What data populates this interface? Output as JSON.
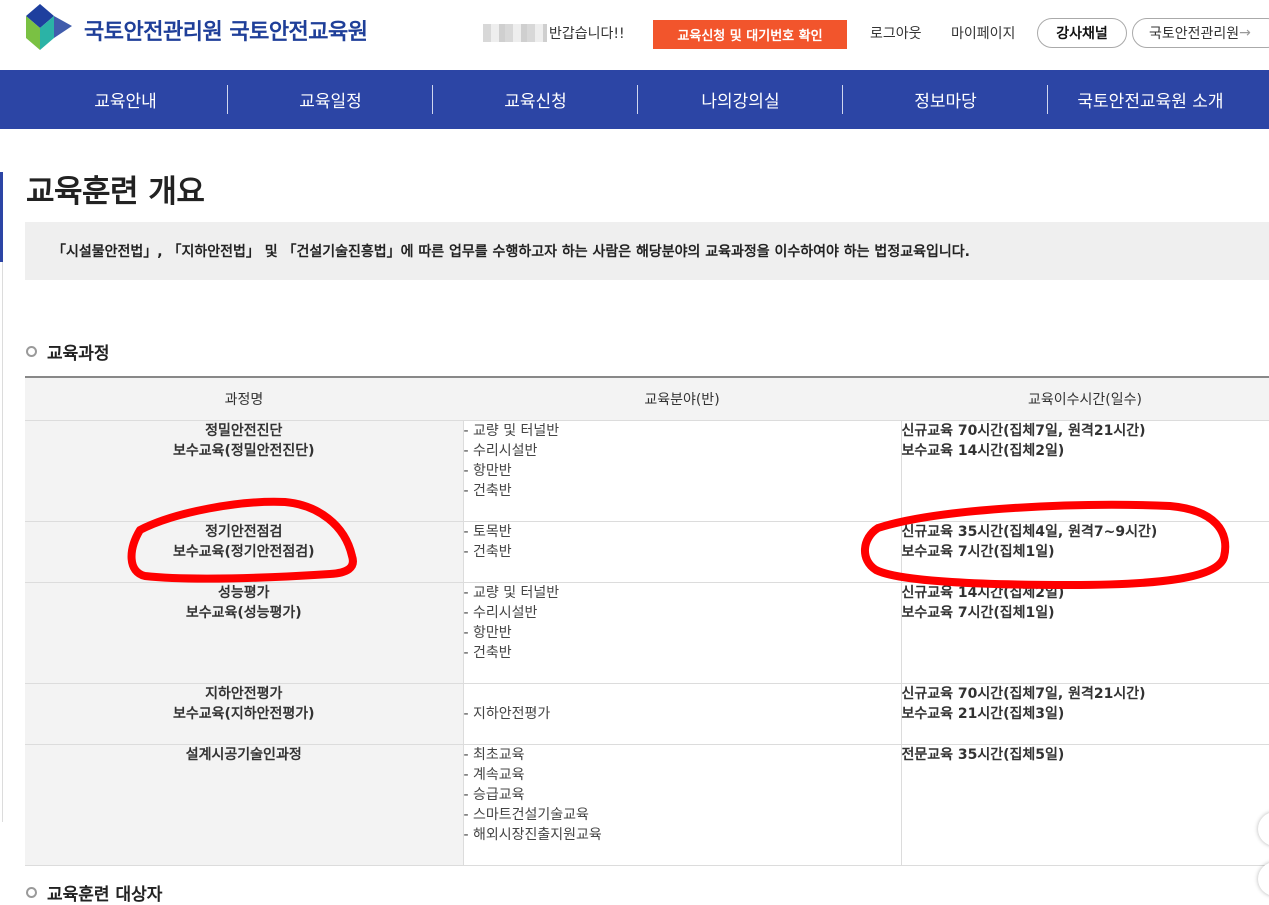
{
  "header": {
    "logo_text": "국토안전관리원 국토안전교육원",
    "greeting": "반갑습니다!!",
    "apply_button": "교육신청 및 대기번호 확인",
    "logout": "로그아웃",
    "mypage": "마이페이지",
    "instructor_channel": "강사채널",
    "kalis_link": "국토안전관리원",
    "kalis_arrow": "→"
  },
  "nav": [
    "교육안내",
    "교육일정",
    "교육신청",
    "나의강의실",
    "정보마당",
    "국토안전교육원 소개"
  ],
  "page": {
    "title": "교육훈련 개요",
    "intro": "「시설물안전법」, 「지하안전법」 및 「건설기술진흥법」에 따른 업무를 수행하고자 하는 사람은 해당분야의 교육과정을 이수하여야 하는 법정교육입니다."
  },
  "section1": "교육과정",
  "section2": "교육훈련 대상자",
  "table": {
    "headers": [
      "과정명",
      "교육분야(반)",
      "교육이수시간(일수)"
    ],
    "rows": [
      {
        "name": [
          "정밀안전진단",
          "보수교육(정밀안전진단)"
        ],
        "fields": [
          "- 교량 및 터널반",
          "- 수리시설반",
          "- 항만반",
          "- 건축반"
        ],
        "hours": [
          "신규교육 70시간(집체7일, 원격21시간)",
          "보수교육 14시간(집체2일)"
        ]
      },
      {
        "name": [
          "정기안전점검",
          "보수교육(정기안전점검)"
        ],
        "fields": [
          "- 토목반",
          "- 건축반"
        ],
        "hours": [
          "신규교육 35시간(집체4일, 원격7~9시간)",
          "보수교육 7시간(집체1일)"
        ]
      },
      {
        "name": [
          "성능평가",
          "보수교육(성능평가)"
        ],
        "fields": [
          "- 교량 및 터널반",
          "- 수리시설반",
          "- 항만반",
          "- 건축반"
        ],
        "hours": [
          "신규교육 14시간(집체2일)",
          "보수교육 7시간(집체1일)"
        ]
      },
      {
        "name": [
          "지하안전평가",
          "보수교육(지하안전평가)"
        ],
        "fields": [
          "- 지하안전평가"
        ],
        "hours": [
          "신규교육 70시간(집체7일, 원격21시간)",
          "보수교육 21시간(집체3일)"
        ]
      },
      {
        "name": [
          "설계시공기술인과정"
        ],
        "fields": [
          "- 최초교육",
          "- 계속교육",
          "- 승급교육",
          "- 스마트건설기술교육",
          "- 해외시장진출지원교육"
        ],
        "hours": [
          "전문교육 35시간(집체5일)"
        ]
      }
    ]
  },
  "colors": {
    "nav_bg": "#2c45a5",
    "logo_text": "#1f3f99",
    "apply_button_bg": "#f2552c",
    "annotation_red": "#ff0000"
  },
  "annotation": {
    "circled_course": "정기안전점검",
    "circled_hours": "신규교육 35시간(집체4일, 원격7~9시간)"
  }
}
